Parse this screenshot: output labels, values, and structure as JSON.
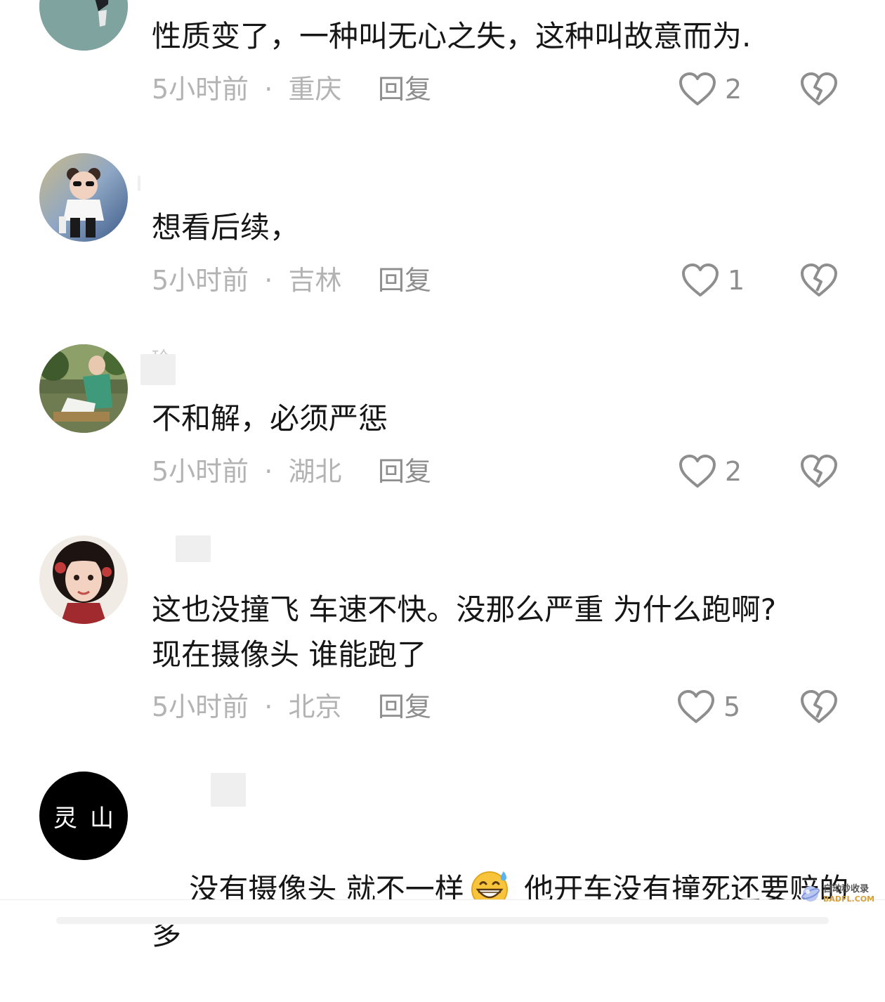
{
  "comments": [
    {
      "username": "",
      "text": "性质变了，一种叫无心之失，这种叫故意而为.",
      "time": "5小时前",
      "separator": "·",
      "location": "重庆",
      "reply": "回复",
      "likes": "2"
    },
    {
      "username": "",
      "text": "想看后续，",
      "time": "5小时前",
      "separator": "·",
      "location": "吉林",
      "reply": "回复",
      "likes": "1"
    },
    {
      "username": "玲",
      "text": "不和解，必须严惩",
      "time": "5小时前",
      "separator": "·",
      "location": "湖北",
      "reply": "回复",
      "likes": "2"
    },
    {
      "username": "",
      "text": "这也没撞飞 车速不快。没那么严重 为什么跑啊?\n现在摄像头 谁能跑了",
      "time": "5小时前",
      "separator": "·",
      "location": "北京",
      "reply": "回复",
      "likes": "5"
    },
    {
      "username": "",
      "avatar_text": "灵山",
      "text_before_emoji": "没有摄像头 就不一样",
      "emoji": "grinning-sweat-emoji",
      "text_after_emoji": " 他开车没有撞死还要赔的多"
    }
  ],
  "watermark": {
    "line1": "自动秒收录",
    "line2": "BADFL.COM"
  },
  "colors": {
    "meta": "#b3b3b3",
    "reply": "#8e8e8e",
    "text": "#161616",
    "icon": "#8e8e8e"
  }
}
